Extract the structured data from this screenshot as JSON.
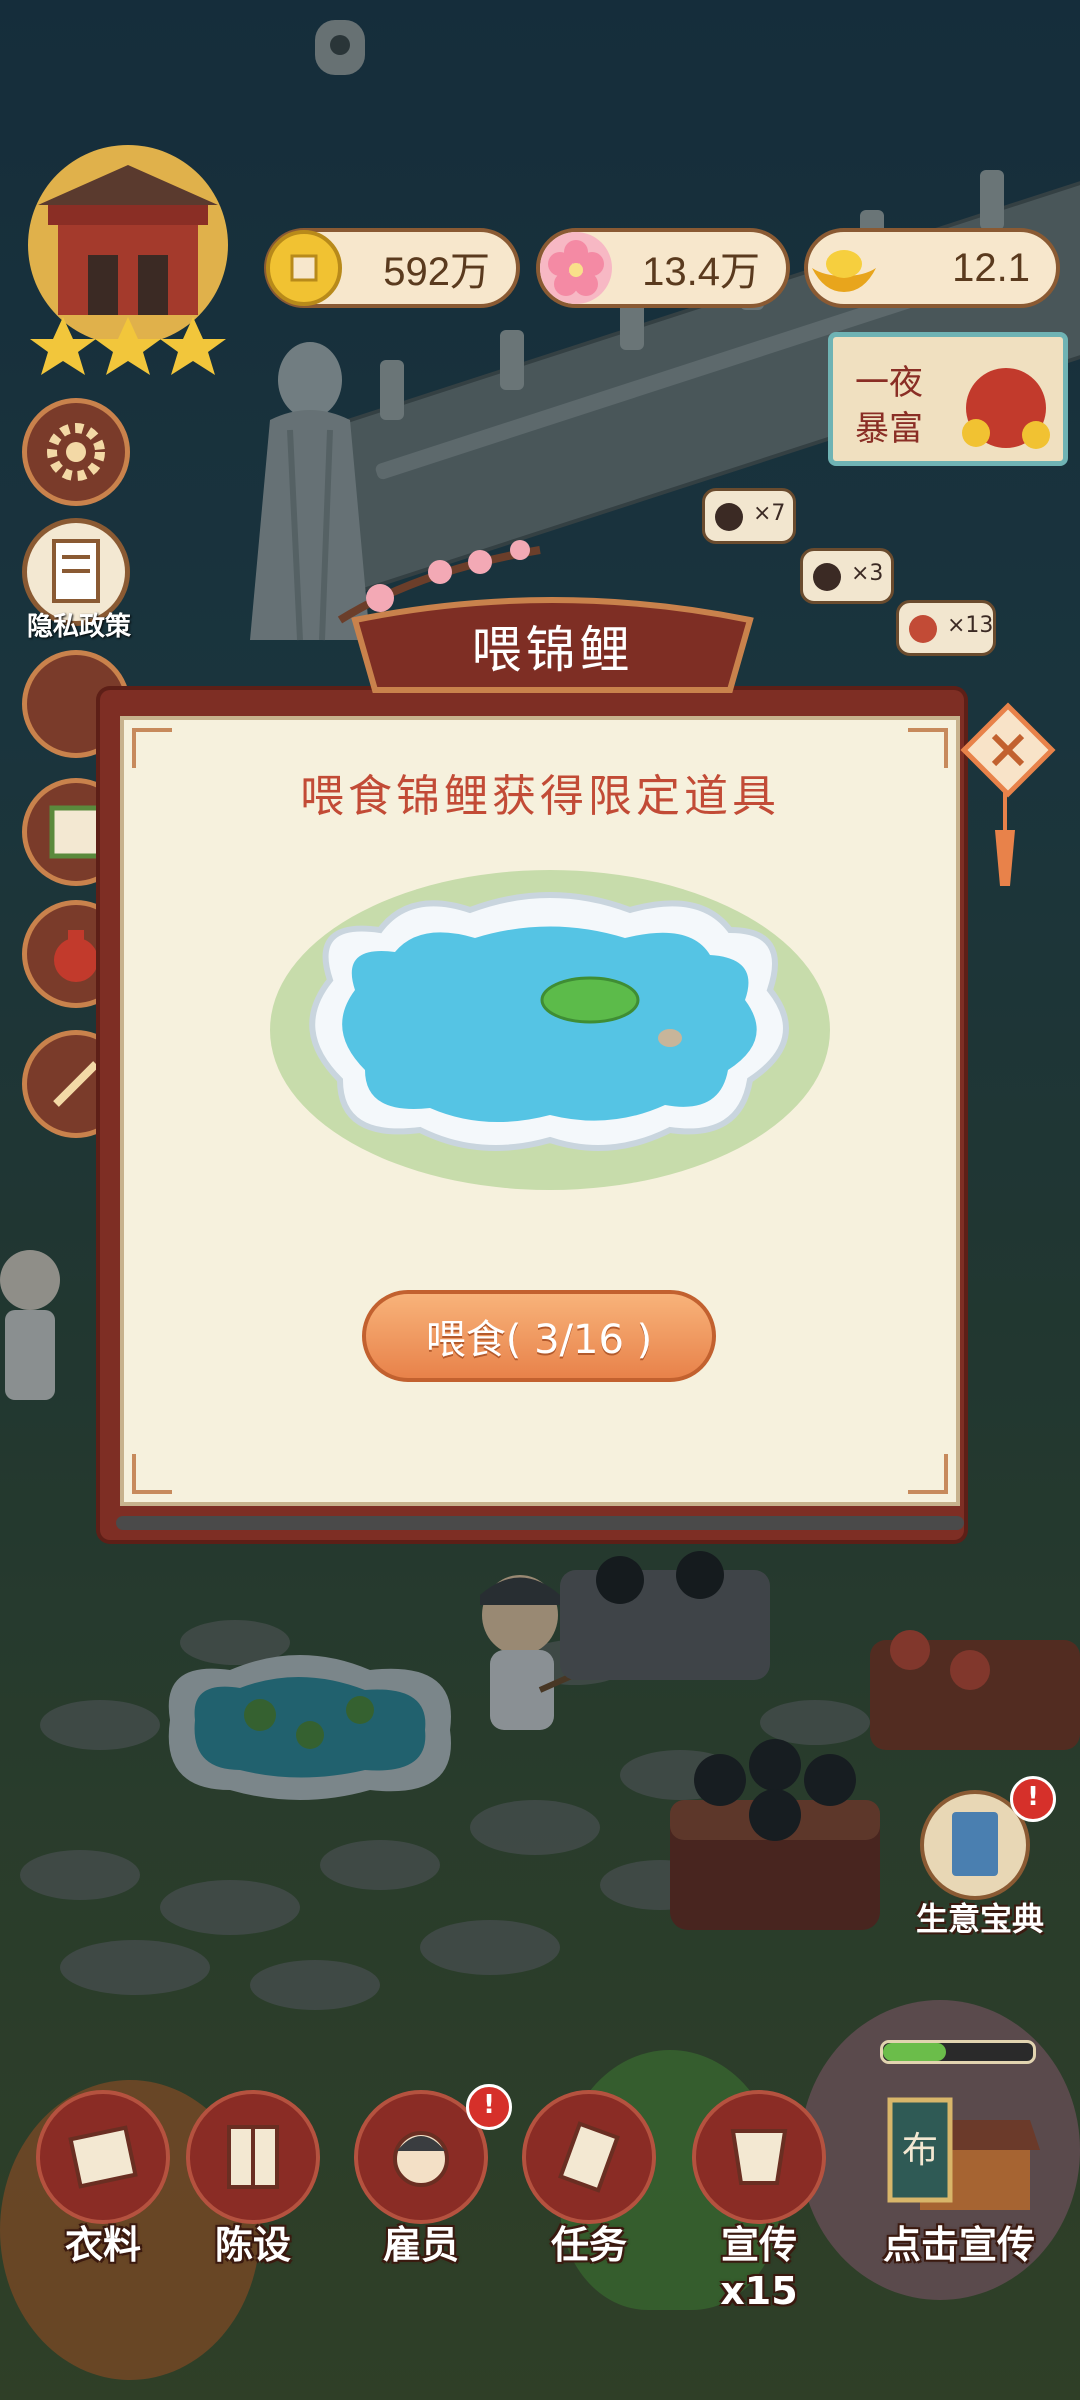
{
  "stats": {
    "coins": "592万",
    "flowers": "13.4万",
    "gold": "12.1"
  },
  "side": {
    "privacy_label": "隐私政策"
  },
  "banner": {
    "line1": "一夜",
    "line2": "暴富"
  },
  "scene": {
    "item_counts": [
      "×7",
      "×3",
      "×13"
    ]
  },
  "modal": {
    "title": "喂锦鲤",
    "subtitle": "喂食锦鲤获得限定道具",
    "feed_button": "喂食( 3/16 )"
  },
  "business_guide": {
    "label": "生意宝典"
  },
  "bottom_nav": [
    {
      "label": "衣料",
      "icon": "fabric-scroll-icon",
      "badge": false
    },
    {
      "label": "陈设",
      "icon": "cabinet-icon",
      "badge": false
    },
    {
      "label": "雇员",
      "icon": "employee-icon",
      "badge": true
    },
    {
      "label": "任务",
      "icon": "task-scroll-icon",
      "badge": false
    },
    {
      "label": "宣传x15",
      "icon": "promotion-banner-icon",
      "badge": false
    },
    {
      "label": "点击宣传",
      "icon": "shop-banner-icon",
      "badge": false
    }
  ],
  "badge_text": "!",
  "colors": {
    "accent_red": "#7e2e24",
    "button_orange": "#e8824a",
    "subtitle_red": "#c24b36"
  }
}
